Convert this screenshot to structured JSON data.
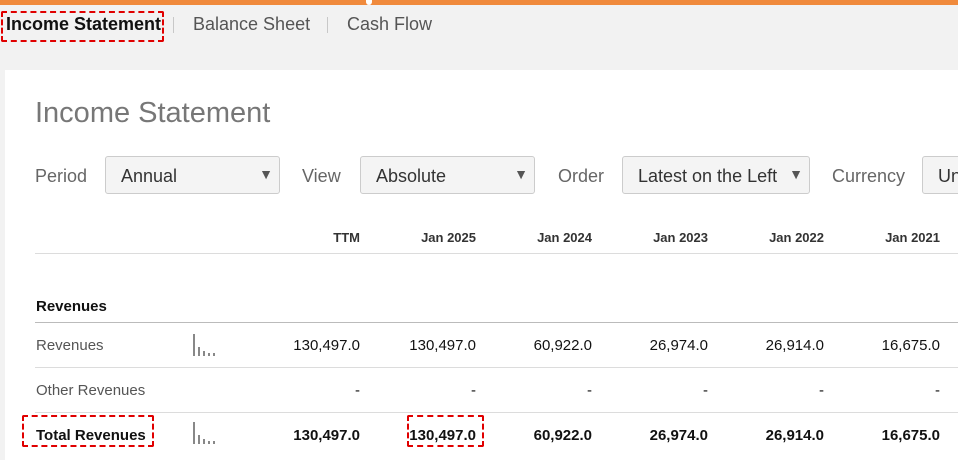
{
  "tabs": [
    {
      "label": "Income Statement",
      "active": true
    },
    {
      "label": "Balance Sheet",
      "active": false
    },
    {
      "label": "Cash Flow",
      "active": false
    }
  ],
  "page_title": "Income Statement",
  "controls": {
    "period": {
      "label": "Period",
      "value": "Annual"
    },
    "view": {
      "label": "View",
      "value": "Absolute"
    },
    "order": {
      "label": "Order",
      "value": "Latest on the Left"
    },
    "currency": {
      "label": "Currency",
      "value": "Un"
    }
  },
  "table": {
    "columns": [
      "TTM",
      "Jan 2025",
      "Jan 2024",
      "Jan 2023",
      "Jan 2022",
      "Jan 2021"
    ],
    "section": "Revenues",
    "rows": [
      {
        "label": "Revenues",
        "values": [
          "130,497.0",
          "130,497.0",
          "60,922.0",
          "26,974.0",
          "26,914.0",
          "16,675.0"
        ]
      },
      {
        "label": "Other Revenues",
        "values": [
          "-",
          "-",
          "-",
          "-",
          "-",
          "-"
        ]
      },
      {
        "label": "Total Revenues",
        "values": [
          "130,497.0",
          "130,497.0",
          "60,922.0",
          "26,974.0",
          "26,914.0",
          "16,675.0"
        ]
      }
    ]
  },
  "colors": {
    "accent": "#f08a3c",
    "highlight": "#e00000"
  }
}
